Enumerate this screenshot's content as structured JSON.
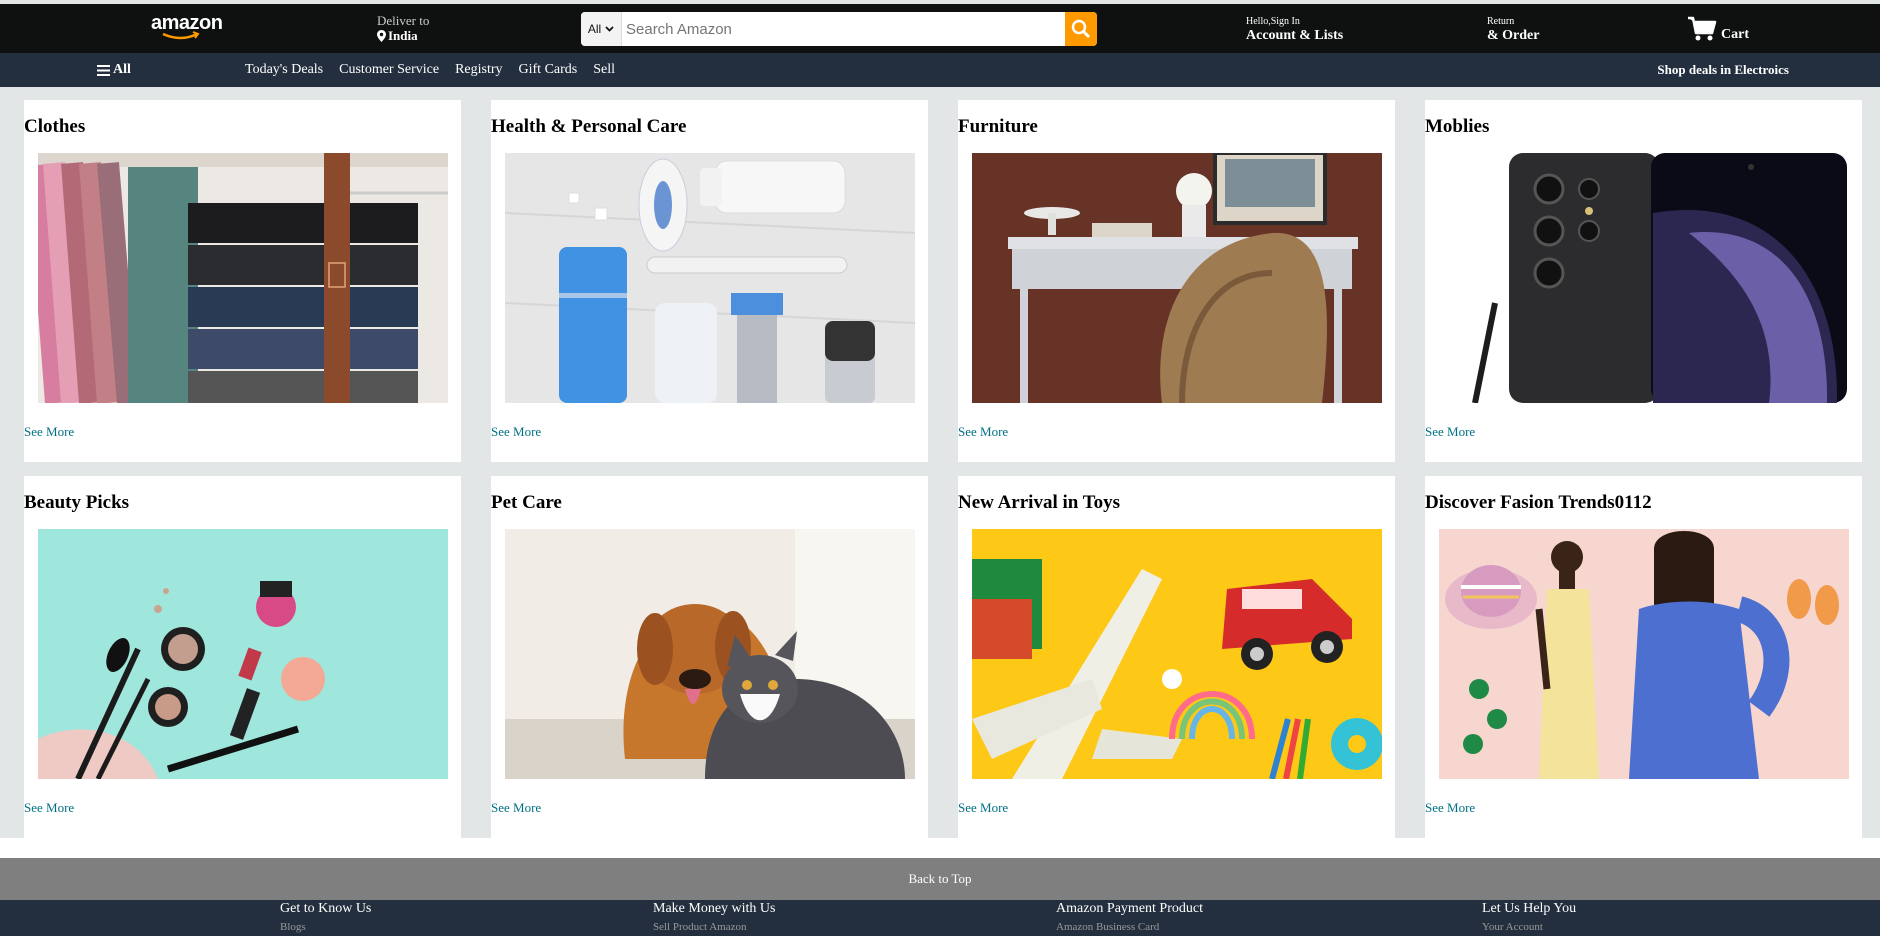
{
  "header": {
    "logo_text": "amazon",
    "deliver_label": "Deliver to",
    "deliver_location": "India",
    "search_category": "All",
    "search_placeholder": "Search Amazon",
    "account_greeting": "Hello,Sign In",
    "account_label": "Account & Lists",
    "returns_small": "Return",
    "returns_big": "& Order",
    "cart_label": "Cart"
  },
  "nav": {
    "all_label": "All",
    "links": [
      "Today's Deals",
      "Customer Service",
      "Registry",
      "Gift Cards",
      "Sell"
    ],
    "promo": "Shop deals in Electroics"
  },
  "cards": [
    {
      "title": "Clothes",
      "image": "clothes-image",
      "link": "See More"
    },
    {
      "title": "Health & Personal Care",
      "image": "health-care-image",
      "link": "See More"
    },
    {
      "title": "Furniture",
      "image": "furniture-image",
      "link": "See More"
    },
    {
      "title": "Moblies",
      "image": "mobile-phone-image",
      "link": "See More"
    },
    {
      "title": "Beauty Picks",
      "image": "beauty-image",
      "link": "See More"
    },
    {
      "title": "Pet Care",
      "image": "pet-care-image",
      "link": "See More"
    },
    {
      "title": "New Arrival in Toys",
      "image": "toys-image",
      "link": "See More"
    },
    {
      "title": "Discover Fasion Trends0112",
      "image": "fashion-image",
      "link": "See More"
    }
  ],
  "footer": {
    "back_to_top": "Back to Top",
    "columns": [
      {
        "heading": "Get to Know Us",
        "first_link": "Blogs"
      },
      {
        "heading": "Make Money with Us",
        "first_link": "Sell Product Amazon"
      },
      {
        "heading": "Amazon Payment Product",
        "first_link": "Amazon Business Card"
      },
      {
        "heading": "Let Us Help You",
        "first_link": "Your Account"
      }
    ]
  },
  "colors": {
    "header_bg": "#0f1111",
    "nav_bg": "#232f3e",
    "search_button": "#ff9900",
    "link": "#007185",
    "page_bg": "#e3e6e6",
    "back_to_top_bg": "#7f7f7f"
  }
}
